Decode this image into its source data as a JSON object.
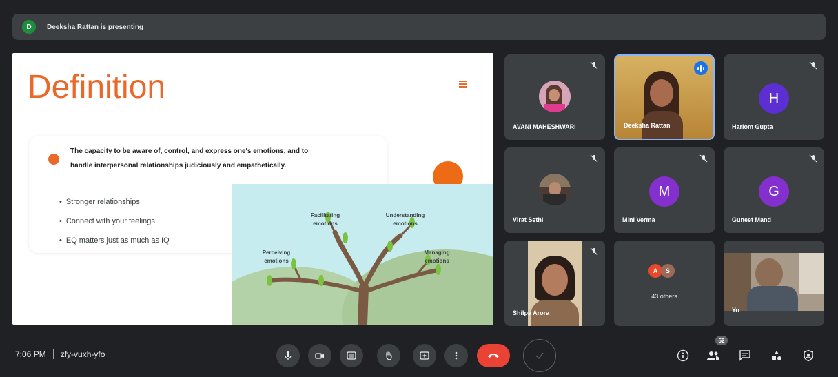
{
  "presentation_banner": {
    "avatar_letter": "D",
    "text": "Deeksha Rattan is presenting"
  },
  "slide": {
    "title": "Definition",
    "definition": "The capacity to be aware of, control, and express one's emotions, and to handle interpersonal relationships judiciously and empathetically.",
    "bullets": [
      "Stronger relationships",
      "Connect with your feelings",
      "EQ matters just as much as IQ"
    ],
    "tree_labels": {
      "facilitating": "Facilitating emotions",
      "understanding": "Understanding emotions",
      "perceiving": "Perceiving emotions",
      "managing": "Managing emotions"
    }
  },
  "participants": [
    {
      "name": "AVANI MAHESHWARI",
      "muted": true
    },
    {
      "name": "Deeksha Rattan",
      "speaking": true
    },
    {
      "name": "Hariom Gupta",
      "letter": "H",
      "color": "#5b2fd1",
      "muted": true
    },
    {
      "name": "Virat Sethi",
      "muted": true
    },
    {
      "name": "Mini Verma",
      "letter": "M",
      "color": "#8430ce",
      "muted": true
    },
    {
      "name": "Guneet Mand",
      "letter": "G",
      "color": "#8430ce",
      "muted": true
    },
    {
      "name": "Shilpa Arora",
      "muted": true
    },
    {
      "name": "Yo"
    }
  ],
  "others": {
    "avatar_a": "A",
    "avatar_b": "S",
    "label": "43 others"
  },
  "bottom_bar": {
    "time": "7:06 PM",
    "meeting_code": "zfy-vuxh-yfo",
    "participant_count": "52"
  },
  "colors": {
    "accent_orange": "#e8692a",
    "end_call_red": "#ea4335",
    "background": "#202124",
    "tile": "#3c4043"
  }
}
